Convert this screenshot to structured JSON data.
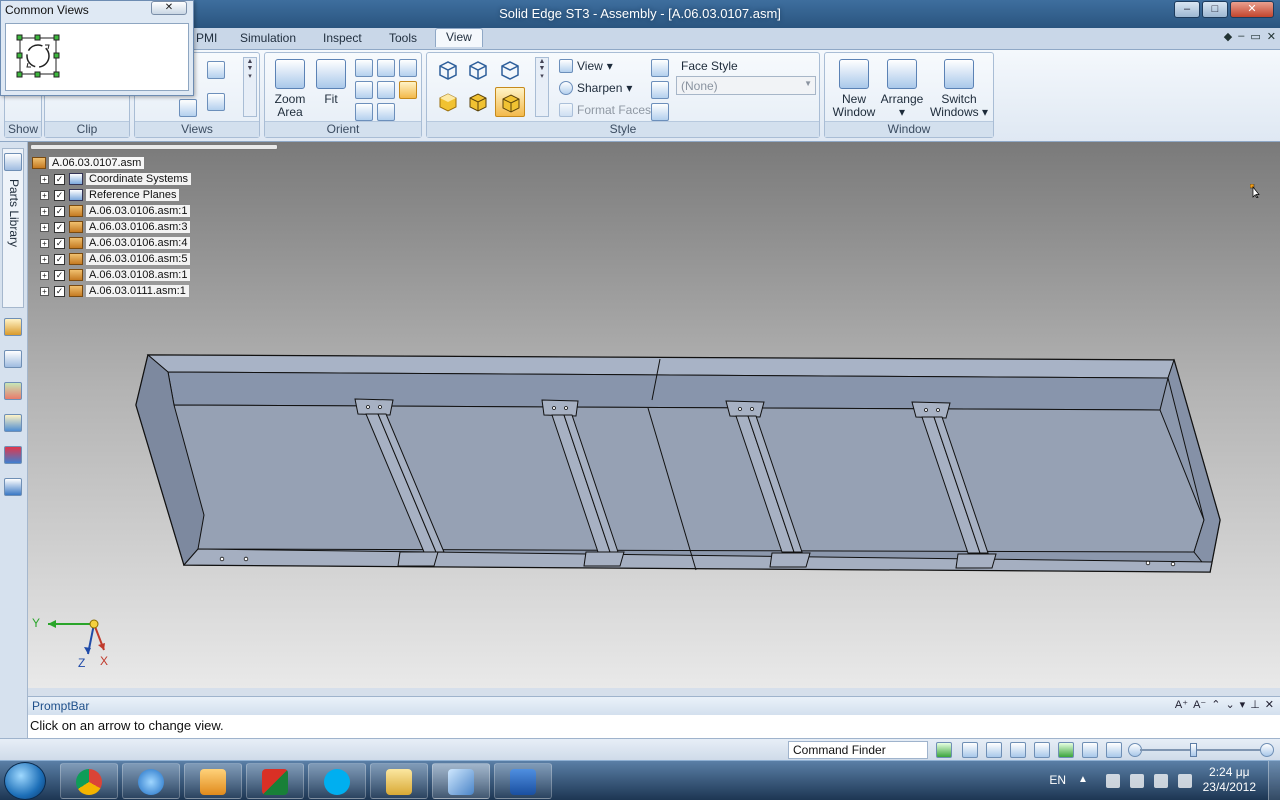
{
  "window": {
    "title": "Solid Edge ST3 - Assembly - [A.06.03.0107.asm]",
    "minimize": "–",
    "maximize": "□",
    "close": "✕"
  },
  "ribbon": {
    "tabs": [
      {
        "label": "PMI"
      },
      {
        "label": "Simulation"
      },
      {
        "label": "Inspect"
      },
      {
        "label": "Tools"
      },
      {
        "label": "View"
      }
    ],
    "show_label": "Show",
    "clip_label": "Clip",
    "views_label": "Views",
    "orient": {
      "label": "Orient",
      "zoom_area": "Zoom\nArea",
      "zoom_area_l1": "Zoom",
      "zoom_area_l2": "Area",
      "fit": "Fit"
    },
    "style": {
      "label": "Style",
      "view": "View",
      "sharpen": "Sharpen",
      "format_faces": "Format Faces",
      "face_style": "Face Style",
      "face_style_value": "(None)"
    },
    "window_group": {
      "label": "Window",
      "new_window_l1": "New",
      "new_window_l2": "Window",
      "arrange": "Arrange",
      "switch_l1": "Switch",
      "switch_l2": "Windows"
    }
  },
  "common_views": {
    "title": "Common Views",
    "close": "✕"
  },
  "left_dock": {
    "parts_library": "Parts Library"
  },
  "pathfinder": {
    "root": "A.06.03.0107.asm",
    "items": [
      {
        "label": "Coordinate Systems"
      },
      {
        "label": "Reference Planes"
      },
      {
        "label": "A.06.03.0106.asm:1"
      },
      {
        "label": "A.06.03.0106.asm:3"
      },
      {
        "label": "A.06.03.0106.asm:4"
      },
      {
        "label": "A.06.03.0106.asm:5"
      },
      {
        "label": "A.06.03.0108.asm:1"
      },
      {
        "label": "A.06.03.0111.asm:1"
      }
    ]
  },
  "triad": {
    "y": "Y",
    "z": "Z",
    "x": "X"
  },
  "promptbar": {
    "title": "PromptBar",
    "message": "Click on an arrow to change view."
  },
  "statusbar": {
    "command_finder": "Command Finder"
  },
  "taskbar": {
    "language": "EN",
    "time": "2:24 μμ",
    "date": "23/4/2012"
  },
  "colors": {
    "accent": "#2a557f",
    "model_face": "#8f9bb0",
    "model_edge": "#1a1a1a"
  }
}
